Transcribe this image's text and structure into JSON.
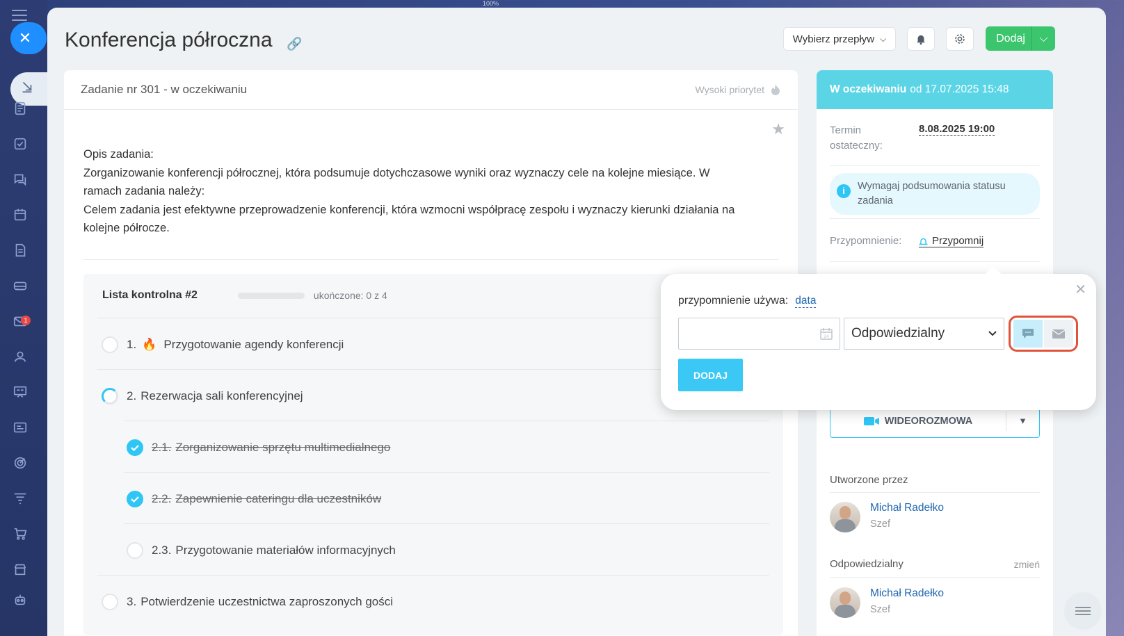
{
  "zoom": "100%",
  "header": {
    "title": "Konferencja półroczna",
    "flow_select": "Wybierz przepływ",
    "add_button": "Dodaj"
  },
  "task": {
    "number_status": "Zadanie nr 301 - w oczekiwaniu",
    "priority": "Wysoki priorytet",
    "description": [
      "Opis zadania:",
      "Zorganizowanie konferencji półrocznej, która podsumuje dotychczasowe wyniki oraz wyznaczy cele na kolejne miesiące. W",
      "ramach zadania należy:",
      "Celem zadania jest efektywne przeprowadzenie konferencji, która wzmocni współpracę zespołu i wyznaczy kierunki działania na",
      "kolejne półrocze."
    ]
  },
  "checklist": {
    "name": "Lista kontrolna #2",
    "completed": "ukończone: 0 z 4",
    "progress": 0,
    "items": [
      {
        "num": "1.",
        "label": "Przygotowanie agendy konferencji",
        "state": "open",
        "important": true
      },
      {
        "num": "2.",
        "label": "Rezerwacja sali konferencyjnej",
        "state": "progress"
      },
      {
        "num": "2.1.",
        "label": "Zorganizowanie sprzętu multimedialnego",
        "state": "done"
      },
      {
        "num": "2.2.",
        "label": "Zapewnienie cateringu dla uczestników",
        "state": "done"
      },
      {
        "num": "2.3.",
        "label": "Przygotowanie materiałów informacyjnych",
        "state": "open"
      },
      {
        "num": "3.",
        "label": "Potwierdzenie uczestnictwa zaproszonych gości",
        "state": "open"
      }
    ]
  },
  "sidebar": {
    "status_bold": "W oczekiwaniu",
    "status_rest": "od 17.07.2025 15:48",
    "deadline_label_1": "Termin",
    "deadline_label_2": "ostateczny:",
    "deadline_value": "8.08.2025 19:00",
    "require_summary_1": "Wymagaj podsumowania statusu",
    "require_summary_2": "zadania",
    "reminder_label": "Przypomnienie:",
    "reminder_link": "Przypomnij",
    "video_call": "WIDEOROZMOWA",
    "created_by_label": "Utworzone przez",
    "creator_name": "Michał Radełko",
    "creator_role": "Szef",
    "responsible_label": "Odpowiedzialny",
    "change_link": "zmień",
    "responsible_name": "Michał Radełko",
    "responsible_role": "Szef"
  },
  "reminder_popup": {
    "uses_label": "przypomnienie używa:",
    "uses_link": "data",
    "date_value": "",
    "recipient_selected": "Odpowiedzialny",
    "add_button": "DODAJ"
  },
  "rail": {
    "mail_badge": "1"
  },
  "colors": {
    "accent": "#2fc6f6",
    "add_green": "#3bc56d",
    "status_header": "#5bd5e6",
    "highlight_ring": "#e0533b"
  }
}
